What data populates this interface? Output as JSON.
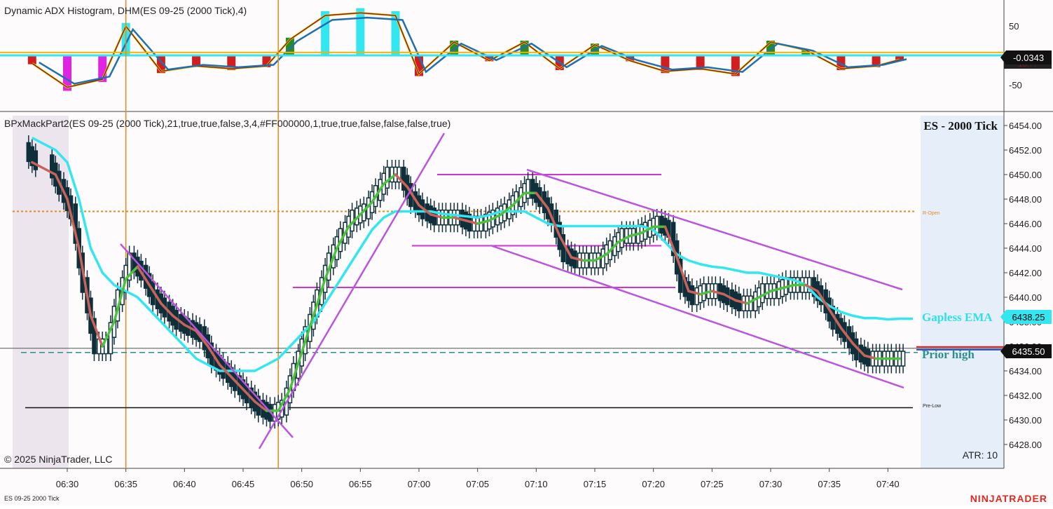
{
  "upper_panel": {
    "title": "Dynamic ADX Histogram, DHM(ES 09-25 (2000 Tick),4)",
    "y_ticks": [
      "50",
      "-50"
    ],
    "value_badge": "-0.0343",
    "hidden_badge": "16.??"
  },
  "main_panel": {
    "title": "BPxMackPart2(ES 09-25 (2000 Tick),21,true,true,false,3,4,#FF000000,1,true,true,false,false,false,true)",
    "instrument_label": "ES - 2000 Tick",
    "copyright": "© 2025 NinjaTrader, LLC",
    "atr_label": "ATR: 10",
    "level_labels": {
      "r_open": "R-Open",
      "pre_low": "Pre-Low",
      "gapless_ema": "Gapless EMA",
      "prior_high": "Prior high"
    },
    "price_badges": [
      "6438.25",
      "6435.50"
    ],
    "y_ticks": [
      "6454.00",
      "6452.00",
      "6450.00",
      "6448.00",
      "6446.00",
      "6444.00",
      "6442.00",
      "6440.00",
      "6438.00",
      "6436.00",
      "6434.00",
      "6432.00",
      "6430.00",
      "6428.00"
    ]
  },
  "time_axis": {
    "labels": [
      "06:30",
      "06:35",
      "06:40",
      "06:45",
      "06:50",
      "06:55",
      "07:00",
      "07:05",
      "07:10",
      "07:15",
      "07:20",
      "07:25",
      "07:30",
      "07:35",
      "07:40"
    ]
  },
  "footer": {
    "series_label": "ES 09-25 2000 Tick",
    "brand": "NINJATRADER"
  },
  "colors": {
    "background": "#fdfbfb",
    "candle": "#0f2f3a",
    "ema_cyan": "#33e6f0",
    "ema_fast": "#c8625a",
    "ema_fast_up": "#4cc13c",
    "trendline": "#bb55dd",
    "h_line": "#d233d2",
    "r_open": "#e68a1c",
    "session_shade": "#ece5ee",
    "future_shade": "#e6eef9",
    "prior_high_text": "#2b8f90",
    "gapless_text": "#2fe0e8",
    "brand": "#e0291f"
  },
  "chart_data": [
    {
      "type": "bar",
      "title": "Dynamic ADX Histogram, DHM(ES 09-25 (2000 Tick),4)",
      "x": [
        "06:27",
        "06:30",
        "06:33",
        "06:35",
        "06:38",
        "06:41",
        "06:44",
        "06:47",
        "06:49",
        "06:52",
        "06:55",
        "06:58",
        "07:00",
        "07:03",
        "07:06",
        "07:09",
        "07:12",
        "07:15",
        "07:18",
        "07:21",
        "07:24",
        "07:27",
        "07:30",
        "07:33",
        "07:36",
        "07:39",
        "07:41"
      ],
      "values": [
        -15,
        -60,
        -45,
        55,
        -30,
        -20,
        -25,
        -20,
        30,
        75,
        80,
        75,
        -35,
        25,
        -10,
        25,
        -25,
        20,
        -10,
        -30,
        -25,
        -35,
        25,
        10,
        -25,
        -20,
        -8
      ],
      "ylim": [
        -100,
        100
      ],
      "y_ticks": [
        50,
        -50
      ],
      "last_value": -0.0343
    },
    {
      "type": "line",
      "title": "BPxMackPart2(ES 09-25 (2000 Tick),21,true,true,false,3,4,#FF000000,1,true,true,false,false,false,true)",
      "x": [
        "06:27",
        "06:29",
        "06:30",
        "06:31",
        "06:32",
        "06:33",
        "06:34",
        "06:35",
        "06:36",
        "06:37",
        "06:38",
        "06:39",
        "06:40",
        "06:41",
        "06:42",
        "06:43",
        "06:44",
        "06:45",
        "06:46",
        "06:47",
        "06:48",
        "06:49",
        "06:50",
        "06:51",
        "06:52",
        "06:53",
        "06:54",
        "06:55",
        "06:56",
        "06:57",
        "06:58",
        "06:59",
        "07:00",
        "07:01",
        "07:02",
        "07:03",
        "07:04",
        "07:05",
        "07:06",
        "07:07",
        "07:08",
        "07:09",
        "07:10",
        "07:11",
        "07:12",
        "07:13",
        "07:14",
        "07:15",
        "07:16",
        "07:17",
        "07:18",
        "07:19",
        "07:20",
        "07:21",
        "07:22",
        "07:23",
        "07:24",
        "07:25",
        "07:26",
        "07:27",
        "07:28",
        "07:29",
        "07:30",
        "07:31",
        "07:32",
        "07:33",
        "07:34",
        "07:35",
        "07:36",
        "07:37",
        "07:38",
        "07:39",
        "07:40",
        "07:41"
      ],
      "series": [
        {
          "values": [
            6451,
            6449,
            6447,
            6441,
            6436,
            6436,
            6440,
            6443,
            6442,
            6440,
            6439,
            6438,
            6437.5,
            6437,
            6435,
            6434,
            6433,
            6432,
            6431,
            6430.5,
            6431,
            6434,
            6437,
            6440,
            6443,
            6445,
            6446.5,
            6447,
            6448.5,
            6450,
            6450,
            6448,
            6447,
            6446.5,
            6446.5,
            6446.5,
            6446,
            6446,
            6446.5,
            6447,
            6448,
            6449,
            6448,
            6446.5,
            6443.5,
            6443,
            6443,
            6443,
            6444,
            6445,
            6445,
            6445.5,
            6446,
            6445.5,
            6441,
            6440,
            6440.5,
            6440.5,
            6440,
            6439.5,
            6439.5,
            6440.5,
            6440.5,
            6441,
            6441,
            6441,
            6440,
            6438,
            6437,
            6435.5,
            6435,
            6435,
            6435,
            6435
          ]
        },
        {
          "values": [
            6453,
            6452,
            6451,
            6448,
            6444,
            6442,
            6441,
            6440.5,
            6440,
            6439,
            6438,
            6437,
            6436,
            6435,
            6434.5,
            6434,
            6434,
            6434,
            6434,
            6434.5,
            6435,
            6436,
            6437,
            6438,
            6439.5,
            6441,
            6442.5,
            6444,
            6445.5,
            6446.5,
            6447,
            6447,
            6447,
            6447,
            6446.8,
            6446.7,
            6446.6,
            6446.5,
            6446.7,
            6447,
            6447,
            6447,
            6446.5,
            6446,
            6445.8,
            6445.8,
            6445.8,
            6445.8,
            6445.8,
            6445.8,
            6445.8,
            6445.8,
            6445.5,
            6444.5,
            6443.5,
            6443,
            6442.7,
            6442.5,
            6442.4,
            6442.2,
            6442,
            6442,
            6441.8,
            6441.6,
            6441.4,
            6441,
            6440,
            6439.3,
            6438.8,
            6438.5,
            6438.3,
            6438.3,
            6438.2,
            6438.25
          ]
        }
      ],
      "ylim": [
        6427,
        6455
      ],
      "y_ticks": [
        6454,
        6452,
        6450,
        6448,
        6446,
        6444,
        6442,
        6440,
        6438,
        6436,
        6434,
        6432,
        6430,
        6428
      ],
      "levels": {
        "r_open": 6447,
        "pre_low": 6431,
        "prior_high": 6435.5,
        "gapless_ema": 6438.25
      }
    }
  ]
}
